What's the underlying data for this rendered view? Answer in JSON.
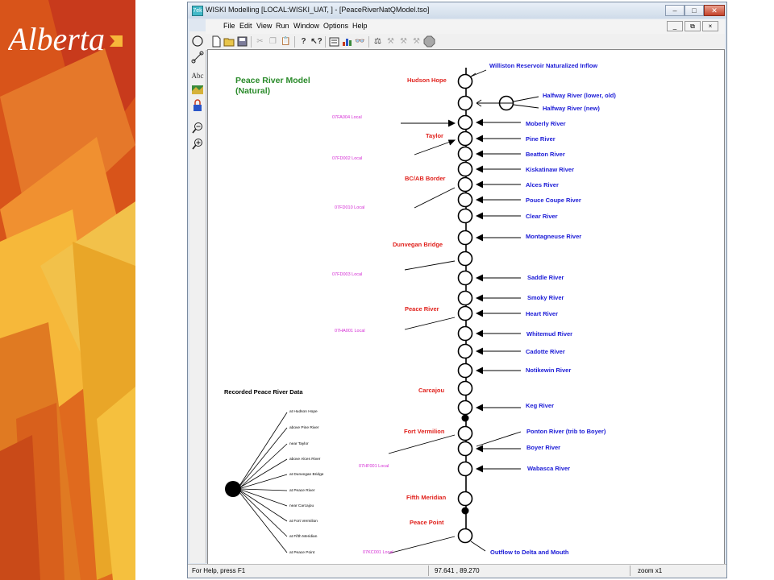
{
  "slide": {
    "logo_text": "Alberta",
    "colors": {
      "orange": "#e26b1e",
      "red": "#c83a1c",
      "yellow": "#f2bb2f",
      "brand": "#ffffff"
    }
  },
  "window": {
    "title": "WISKI Modelling [LOCAL:WISKI_UAT, ] - [PeaceRiverNatQModel.tso]",
    "app_icon_text": "7ek",
    "controls": {
      "minimize": "–",
      "maximize": "□",
      "close": "✕"
    },
    "mdi_controls": {
      "minimize": "_",
      "restore": "⧉",
      "close": "×"
    }
  },
  "menu": [
    "File",
    "Edit",
    "View",
    "Run",
    "Window",
    "Options",
    "Help"
  ],
  "toolbar": {
    "icons": [
      "new-document",
      "open-folder",
      "save",
      "cut",
      "copy",
      "paste",
      "help",
      "context-help",
      "properties",
      "chart",
      "view",
      "run",
      "tool-1",
      "tool-2",
      "tool-3",
      "stop"
    ]
  },
  "palette": {
    "icons": [
      "circle-node",
      "connector",
      "text",
      "map-layer",
      "lock",
      "zoom-out",
      "zoom-in"
    ],
    "text_tool_label": "Abc"
  },
  "model": {
    "title_line1": "Peace River Model",
    "title_line2": "(Natural)",
    "stations": [
      "Hudson Hope",
      "Taylor",
      "BC/AB Border",
      "Dunvegan Bridge",
      "Peace River",
      "Carcajou",
      "Fort Vermilion",
      "Fifth Meridian",
      "Peace Point"
    ],
    "local_inflows": [
      "07FA004 Local",
      "07FD002 Local",
      "07FD010 Local",
      "07FD003 Local",
      "07HA001 Local",
      "07HF001 Local",
      "07KC001 Local"
    ],
    "tributaries": [
      "Williston Reservoir Naturalized Inflow",
      "Halfway River (lower, old)",
      "Halfway River (new)",
      "Moberly River",
      "Pine River",
      "Beatton River",
      "Kiskatinaw River",
      "Alces River",
      "Pouce Coupe River",
      "Clear River",
      "Montagneuse River",
      "Saddle River",
      "Smoky River",
      "Heart River",
      "Whitemud River",
      "Cadotte River",
      "Notikewin River",
      "Keg River",
      "Ponton River (trib to Boyer)",
      "Boyer River",
      "Wabasca River",
      "Outflow to Delta and Mouth"
    ],
    "recorded": {
      "title": "Recorded Peace River Data",
      "items": [
        "at Hudson Hope",
        "above Pine River",
        "near Taylor",
        "above Alces River",
        "at Dunvegan Bridge",
        "at Peace River",
        "near Carcajou",
        "at Fort Vermilion",
        "at Fifth Meridian",
        "at Peace Point"
      ]
    },
    "colors": {
      "station": "#e0211c",
      "tributary": "#1a1ad6",
      "local": "#d42ad4",
      "line": "#000000"
    }
  },
  "status": {
    "help": "For Help, press F1",
    "coords": "97.641 ,  89.270",
    "zoom": "zoom x1"
  }
}
